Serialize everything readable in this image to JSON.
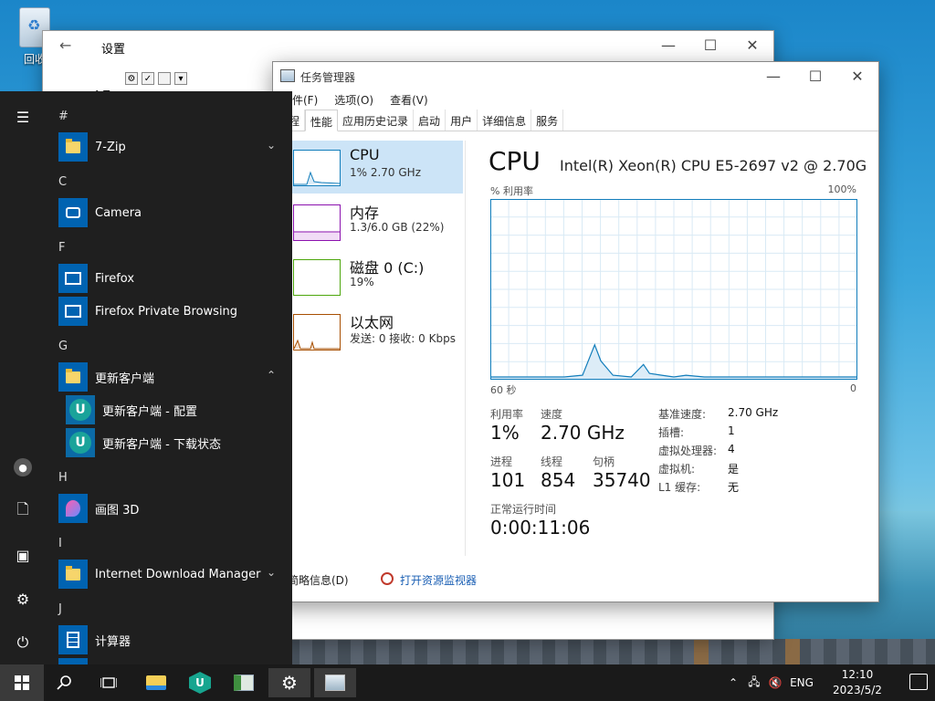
{
  "desktop": {
    "recycle_bin_label": "回收"
  },
  "settings_window": {
    "title": "设置",
    "heading_fragment": "← 设"
  },
  "task_manager": {
    "title": "任务管理器",
    "menu": [
      "文件(F)",
      "选项(O)",
      "查看(V)"
    ],
    "tabs": [
      "进程",
      "性能",
      "应用历史记录",
      "启动",
      "用户",
      "详细信息",
      "服务"
    ],
    "active_tab": "性能",
    "resources": [
      {
        "name": "CPU",
        "value": "1% 2.70 GHz",
        "color": "#117dbb"
      },
      {
        "name": "内存",
        "value": "1.3/6.0 GB (22%)",
        "color": "#8b12ae"
      },
      {
        "name": "磁盘 0 (C:)",
        "value": "19%",
        "color": "#4da60c"
      },
      {
        "name": "以太网",
        "value": "发送: 0 接收: 0 Kbps",
        "color": "#a74f01"
      }
    ],
    "cpu_title": "CPU",
    "cpu_model": "Intel(R) Xeon(R) CPU E5-2697 v2 @ 2.70G...",
    "graph_label_left": "% 利用率",
    "graph_label_right": "100%",
    "axis_left": "60 秒",
    "axis_right": "0",
    "stats": {
      "utilization_label": "利用率",
      "utilization": "1%",
      "speed_label": "速度",
      "speed": "2.70 GHz",
      "processes_label": "进程",
      "processes": "101",
      "threads_label": "线程",
      "threads": "854",
      "handles_label": "句柄",
      "handles": "35740",
      "uptime_label": "正常运行时间",
      "uptime": "0:00:11:06"
    },
    "specs": [
      {
        "k": "基准速度:",
        "v": "2.70 GHz"
      },
      {
        "k": "插槽:",
        "v": "1"
      },
      {
        "k": "虚拟处理器:",
        "v": "4"
      },
      {
        "k": "虚拟机:",
        "v": "是"
      },
      {
        "k": "L1 缓存:",
        "v": "无"
      }
    ],
    "footer": {
      "brief": "简略信息(D)",
      "resource_monitor": "打开资源监视器"
    }
  },
  "chart_data": {
    "type": "area",
    "ylabel": "% 利用率",
    "ylim": [
      0,
      100
    ],
    "x": [
      60,
      57,
      54,
      51,
      48,
      45,
      43,
      42,
      40,
      37,
      35,
      34,
      32,
      30,
      28,
      25,
      22,
      19,
      16,
      13,
      10,
      7,
      4,
      0
    ],
    "values": [
      1,
      1,
      1,
      1,
      1,
      2,
      19,
      10,
      2,
      1,
      8,
      3,
      2,
      1,
      2,
      1,
      1,
      1,
      1,
      1,
      1,
      1,
      1,
      1
    ],
    "color": "#117dbb"
  },
  "start_menu": {
    "sections": [
      {
        "letter": "#",
        "apps": [
          {
            "label": "7-Zip",
            "icon": "folder-icon",
            "expand": "down"
          }
        ]
      },
      {
        "letter": "C",
        "apps": [
          {
            "label": "Camera",
            "icon": "camera-icon"
          }
        ]
      },
      {
        "letter": "F",
        "apps": [
          {
            "label": "Firefox",
            "icon": "firefox-icon"
          },
          {
            "label": "Firefox Private Browsing",
            "icon": "firefox-private-icon"
          }
        ]
      },
      {
        "letter": "G",
        "apps": [
          {
            "label": "更新客户端",
            "icon": "folder-icon",
            "expand": "up"
          }
        ]
      },
      {
        "letter": "H",
        "apps": [
          {
            "label": "画图 3D",
            "icon": "paint3d-icon"
          }
        ]
      },
      {
        "letter": "I",
        "apps": [
          {
            "label": "Internet Download Manager",
            "icon": "folder-icon",
            "expand": "down"
          }
        ]
      },
      {
        "letter": "J",
        "apps": [
          {
            "label": "计算器",
            "icon": "calculator-icon"
          }
        ]
      }
    ],
    "subitems": [
      "更新客户端 - 配置",
      "更新客户端 - 下载状态"
    ]
  },
  "taskbar": {
    "language": "ENG",
    "time": "12:10",
    "date": "2023/5/2"
  }
}
